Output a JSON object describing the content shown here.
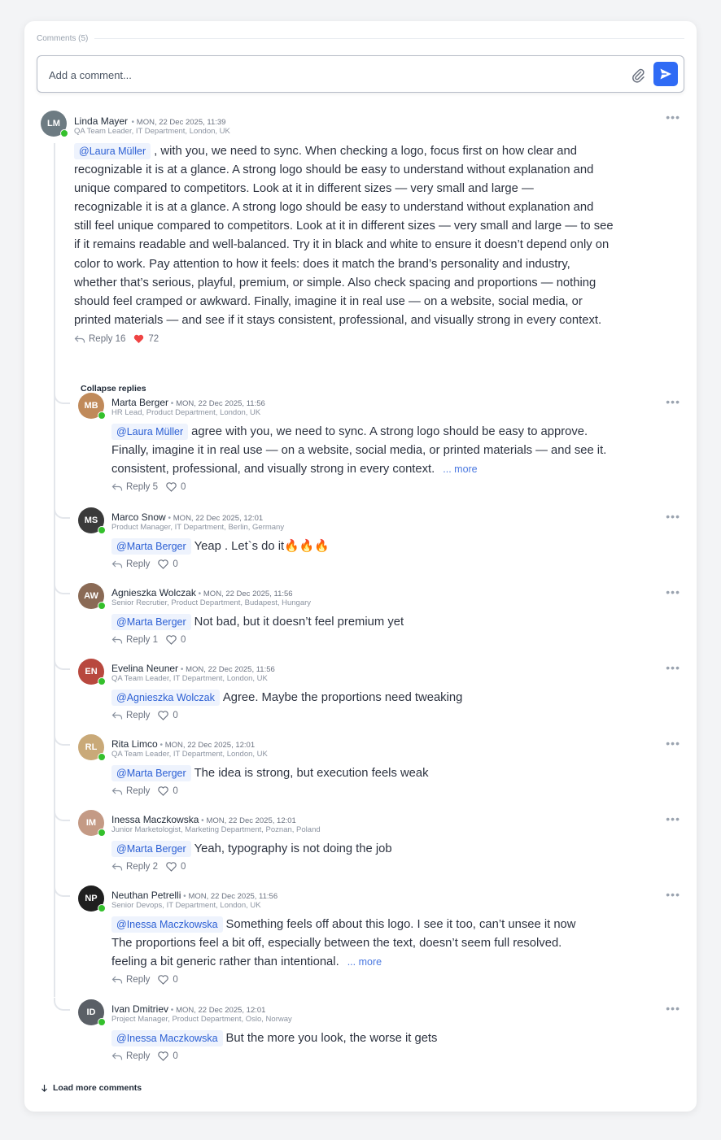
{
  "section": {
    "title": "Comments (5)"
  },
  "input": {
    "placeholder": "Add a comment..."
  },
  "icons": {
    "attach": "paperclip-icon",
    "send": "send-icon",
    "reply": "reply-arrow-icon",
    "like": "heart-icon",
    "more": "more-dots-icon",
    "load": "arrow-down-icon"
  },
  "colors": {
    "accent": "#2f6bf5",
    "online": "#34c02c",
    "liked": "#ef4444",
    "mention_bg": "#eef3fd",
    "mention_text": "#2b5fd4"
  },
  "main_comment": {
    "author": "Linda Mayer",
    "date": "MON, 22 Dec 2025, 11:39",
    "role": "QA Team Leader, IT Department, London, UK",
    "mention": "@Laura Müller",
    "lines": [
      ", with you, we need to sync. When checking a logo, focus first on how clear and",
      "recognizable it is at a glance. A strong logo should be easy to understand without explanation and",
      "unique compared to competitors. Look at it in different sizes — very small and large —",
      "recognizable it is at a glance. A strong logo should be easy to understand without explanation and",
      "still feel unique compared to competitors. Look at it in different sizes — very small and large — to see",
      "if it remains readable and well-balanced. Try it in black and white to ensure it doesn’t depend only on",
      "color to work. Pay attention to how it feels: does it match the brand’s personality and industry,",
      "whether that’s serious, playful, premium, or simple. Also check spacing and proportions — nothing",
      "should feel cramped or awkward. Finally, imagine it in real use — on a website, social media, or",
      "printed materials — and see if it stays consistent, professional, and visually strong in every context."
    ],
    "reply_label": "Reply 16",
    "likes": "72",
    "collapse_label": "Collapse replies"
  },
  "replies": [
    {
      "author": "Marta Berger",
      "date": "MON, 22 Dec 2025, 11:56",
      "role": "HR Lead, Product Department, London, UK",
      "mention": "@Laura Müller",
      "lines": [
        "agree with you, we need to sync. A strong logo should be easy to approve.",
        "Finally, imagine it in real use — on a website, social media, or printed materials — and see it.",
        "consistent, professional, and visually strong in every context."
      ],
      "more": "... more",
      "reply_label": "Reply 5",
      "likes": "0",
      "initials": "MB",
      "color": "#c08a5a"
    },
    {
      "author": "Marco Snow",
      "date": "MON, 22 Dec 2025, 12:01",
      "role": "Product Manager, IT Department, Berlin, Germany",
      "mention": "@Marta Berger",
      "lines": [
        "Yeap . Let`s do it🔥🔥🔥"
      ],
      "more": "",
      "reply_label": "Reply",
      "likes": "0",
      "initials": "MS",
      "color": "#3a3a3a"
    },
    {
      "author": "Agnieszka Wolczak",
      "date": "MON, 22 Dec 2025, 11:56",
      "role": "Senior Recrutier, Product Department, Budapest, Hungary",
      "mention": "@Marta Berger",
      "lines": [
        "Not bad, but it doesn’t feel premium yet"
      ],
      "more": "",
      "reply_label": "Reply 1",
      "likes": "0",
      "initials": "AW",
      "color": "#8a6a55"
    },
    {
      "author": "Evelina Neuner",
      "date": "MON, 22 Dec 2025, 11:56",
      "role": "QA Team Leader, IT Department, London, UK",
      "mention": "@Agnieszka Wolczak",
      "lines": [
        "Agree. Maybe the proportions need tweaking"
      ],
      "more": "",
      "reply_label": "Reply",
      "likes": "0",
      "initials": "EN",
      "color": "#b8483e"
    },
    {
      "author": "Rita Limco",
      "date": "MON, 22 Dec 2025, 12:01",
      "role": "QA Team Leader, IT Department, London, UK",
      "mention": "@Marta Berger",
      "lines": [
        "The idea is strong, but execution feels weak"
      ],
      "more": "",
      "reply_label": "Reply",
      "likes": "0",
      "initials": "RL",
      "color": "#c9a978"
    },
    {
      "author": "Inessa Maczkowska",
      "date": "MON, 22 Dec 2025, 12:01",
      "role": "Junior Marketologist, Marketing Department, Poznan, Poland",
      "mention": "@Marta Berger",
      "lines": [
        "Yeah, typography is not doing the job"
      ],
      "more": "",
      "reply_label": "Reply 2",
      "likes": "0",
      "initials": "IM",
      "color": "#c49a85"
    },
    {
      "author": "Neuthan Petrelli",
      "date": "MON, 22 Dec 2025, 11:56",
      "role": "Senior Devops, IT Department, London, UK",
      "mention": "@Inessa Maczkowska",
      "lines": [
        "Something feels off about this logo. I see it too, can’t unsee it now",
        "The proportions feel a bit off, especially between the text, doesn’t seem full resolved.",
        "feeling a bit generic rather than intentional."
      ],
      "more": "... more",
      "reply_label": "Reply",
      "likes": "0",
      "initials": "NP",
      "color": "#1f1f1f"
    },
    {
      "author": "Ivan Dmitriev",
      "date": "MON, 22 Dec 2025, 12:01",
      "role": "Project Manager, Product Department, Oslo, Norway",
      "mention": "@Inessa Maczkowska",
      "lines": [
        "But the more you look, the worse it gets"
      ],
      "more": "",
      "reply_label": "Reply",
      "likes": "0",
      "initials": "ID",
      "color": "#5a5f66"
    }
  ],
  "load_more": "Load more comments"
}
